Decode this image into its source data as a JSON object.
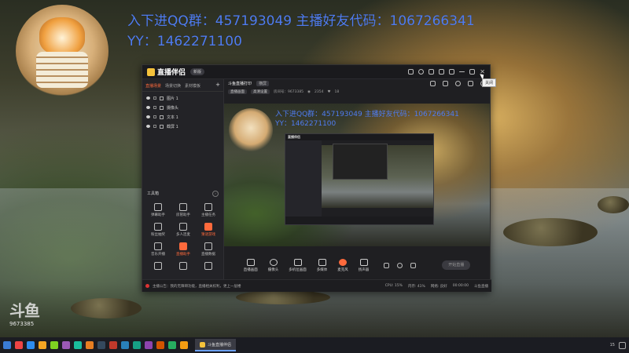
{
  "overlay": {
    "line1": "入下进QQ群：457193049  主播好友代码：1067266341",
    "line2": "YY：1462271100"
  },
  "app": {
    "name": "直播伴侣",
    "version": "新版",
    "tooltip": "关闭"
  },
  "scene_tabs": [
    "直播场景",
    "场景切换",
    "素材模板"
  ],
  "layers": [
    "图片 1",
    "摄像头",
    "文本 1",
    "截屏 1"
  ],
  "toolbox": {
    "title": "工具箱",
    "tools": [
      {
        "label": "弹幕助手",
        "hot": false
      },
      {
        "label": "房管助手",
        "hot": false
      },
      {
        "label": "主播任务",
        "hot": false
      },
      {
        "label": "粉丝抽奖",
        "hot": false
      },
      {
        "label": "多人连麦",
        "hot": false
      },
      {
        "label": "猜谜游戏",
        "hot": true
      },
      {
        "label": "音乐开播",
        "hot": false
      },
      {
        "label": "直播助手",
        "hot": true
      },
      {
        "label": "直播数据",
        "hot": false
      },
      {
        "label": "",
        "hot": false
      },
      {
        "label": "",
        "hot": false
      },
      {
        "label": "",
        "hot": false
      }
    ]
  },
  "main_tabs": {
    "active": "斗鱼直播打印",
    "tag": "横屏",
    "icons": [
      "share-icon",
      "settings-icon",
      "mic-icon",
      "record-icon",
      "share-out-icon"
    ]
  },
  "infobar": {
    "mode": "直播画面",
    "quality": "高清设置",
    "room_label": "房间号：9673385",
    "online": "2354",
    "fans": "18"
  },
  "preview_text": {
    "line1": "入下进QQ群：457193049  主播好友代码：1067266341",
    "line2": "YY：1462271100"
  },
  "bottom_buttons": [
    {
      "label": "直播画面",
      "icon": "screen-icon"
    },
    {
      "label": "摄像头",
      "icon": "camera-icon"
    },
    {
      "label": "多机位画面",
      "icon": "multicam-icon"
    },
    {
      "label": "多媒体",
      "icon": "media-icon"
    },
    {
      "label": "麦克风",
      "icon": "mic-icon",
      "hot": true
    },
    {
      "label": "扬声器",
      "icon": "speaker-icon"
    }
  ],
  "start_button": "开始直播",
  "status": {
    "message": "主播公告：我的无障碍功能，直播相关权利，更上一层楼",
    "right": [
      "CPU: 15%",
      "内存: 41%",
      "网络: 良好",
      "00:00:00",
      "斗鱼直播"
    ]
  },
  "watermark": {
    "brand": "斗鱼",
    "room_id": "9673385"
  },
  "taskbar": {
    "active_app": "斗鱼直播伴侣",
    "tray_text": "15"
  }
}
